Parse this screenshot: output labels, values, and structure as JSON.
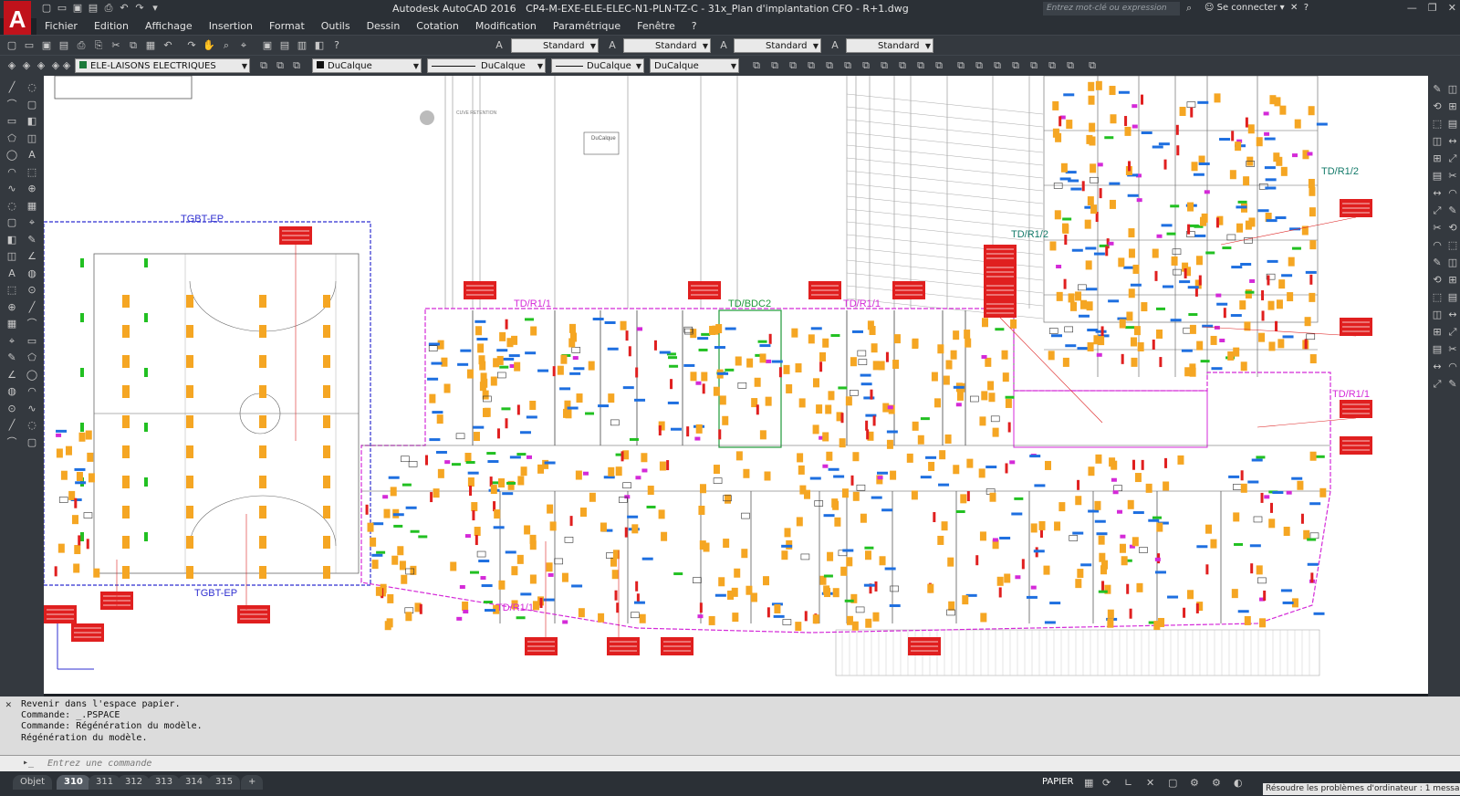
{
  "window": {
    "app_title": "Autodesk AutoCAD 2016",
    "file_title": "CP4-M-EXE-ELE-ELEC-N1-PLN-TZ-C - 31x_Plan d'implantation CFO - R+1.dwg",
    "search_placeholder": "Entrez mot-clé ou expression",
    "signin_label": "Se connecter"
  },
  "menu": {
    "items": [
      "Fichier",
      "Edition",
      "Affichage",
      "Insertion",
      "Format",
      "Outils",
      "Dessin",
      "Cotation",
      "Modification",
      "Paramétrique",
      "Fenêtre",
      "?"
    ]
  },
  "toolbar1": {
    "style_combos": [
      "Standard",
      "Standard",
      "Standard",
      "Standard"
    ]
  },
  "toolbar2": {
    "layer": "ELE-LAISONS ELECTRIQUES",
    "color": "DuCalque",
    "linetype": "DuCalque",
    "lineweight": "DuCalque",
    "plotstyle": "DuCalque"
  },
  "drawing": {
    "labels": {
      "tgbt_top": "TGBT-EP",
      "tgbt_bottom": "TGBT-EP",
      "tdr11_a": "TD/R1/1",
      "tdbdc2": "TD/BDC2",
      "tdr11_b": "TD/R1/1",
      "tdr12_a": "TD/R1/2",
      "tdr12_b": "TD/R1/2",
      "tdr11_c": "TD/R1/1",
      "tdr11_d": "TD/R1/1",
      "cuve": "CUVE RETENTION",
      "ducalque": "DuCalque"
    }
  },
  "command": {
    "history": [
      "Revenir dans l'espace papier.",
      "Commande: _.PSPACE",
      "Commande: Régénération du modèle.",
      "Régénération du modèle."
    ],
    "placeholder": "Entrez une commande"
  },
  "status": {
    "layout_tabs": [
      "Objet",
      "310",
      "311",
      "312",
      "313",
      "314",
      "315"
    ],
    "active_tab": "310",
    "add_tab": "+",
    "space": "PAPIER",
    "notification": "Résoudre les problèmes d'ordinateur : 1 message"
  },
  "colors": {
    "accent_red": "#c0121b",
    "orange": "#f5a623",
    "magenta": "#d42ad8",
    "blue_outline": "#2f2fd0"
  }
}
